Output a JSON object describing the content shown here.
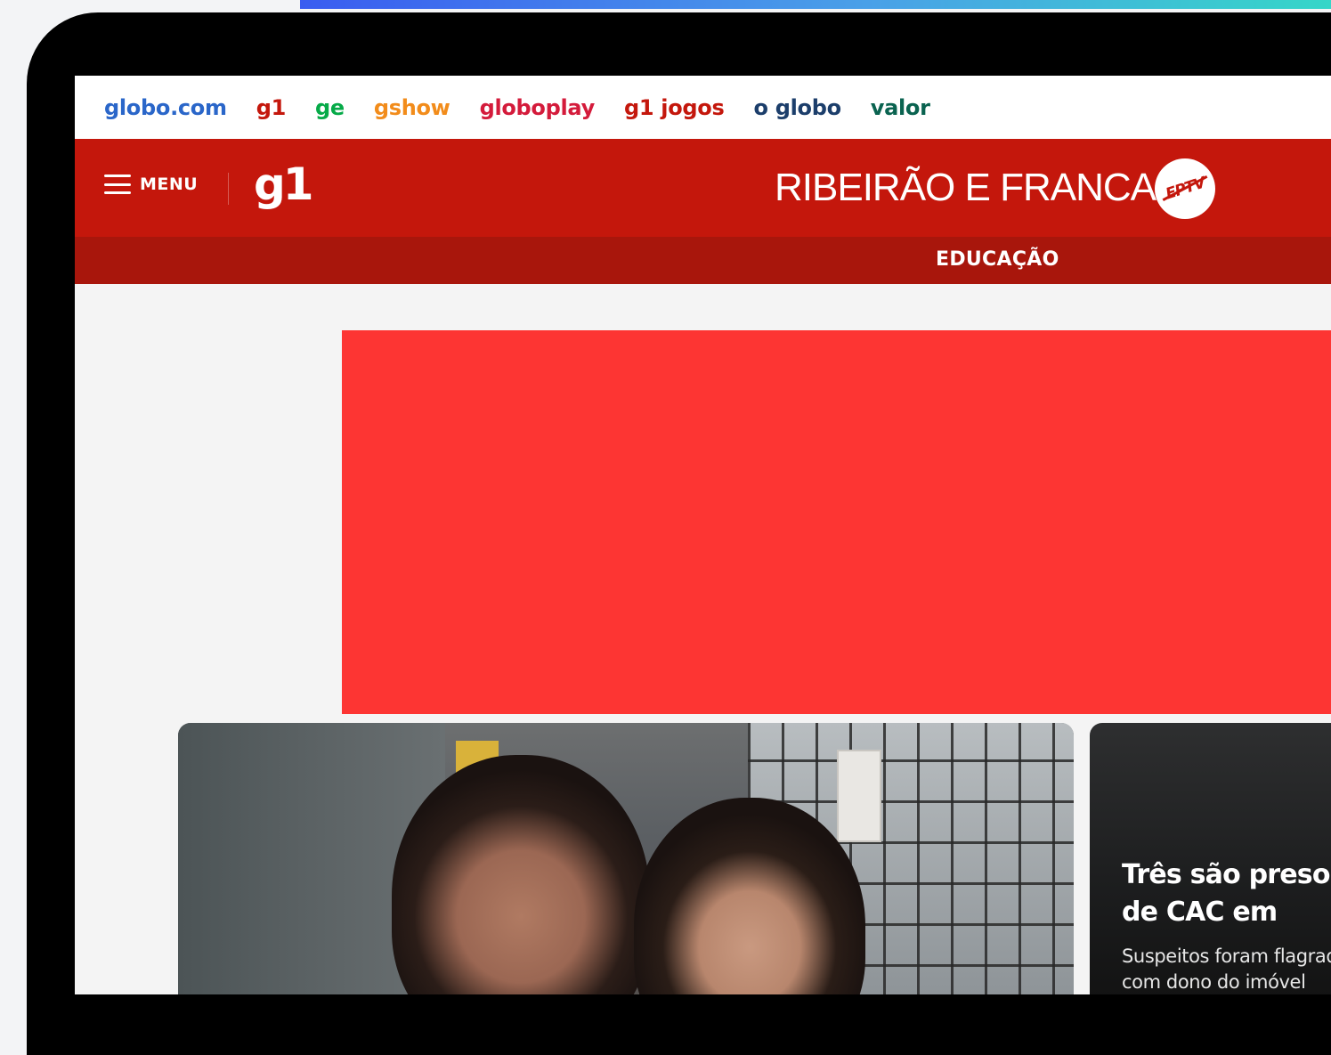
{
  "globo_bar": {
    "links": [
      {
        "label": "globo.com",
        "color": "#2a66c9"
      },
      {
        "label": "g1",
        "color": "#c4170c"
      },
      {
        "label": "ge",
        "color": "#06aa48"
      },
      {
        "label": "gshow",
        "color": "#f28c1b"
      },
      {
        "label": "globoplay",
        "color": "#d41b3b"
      },
      {
        "label": "g1 jogos",
        "color": "#c4170c"
      },
      {
        "label": "o globo",
        "color": "#1c3e6b"
      },
      {
        "label": "valor",
        "color": "#0a6350"
      }
    ]
  },
  "header": {
    "menu_label": "MENU",
    "logo_text": "g1",
    "region_title": "RIBEIRÃO E FRANCA",
    "affiliate_badge": "EPTV",
    "brand_color": "#c4170c"
  },
  "section": {
    "label": "EDUCAÇÃO"
  },
  "ad": {
    "color": "#fd3533"
  },
  "side_story": {
    "headline": "Três são presos em casa de CAC em",
    "summary": "Suspeitos foram flagrados trocando tiros com dono do imóvel"
  }
}
